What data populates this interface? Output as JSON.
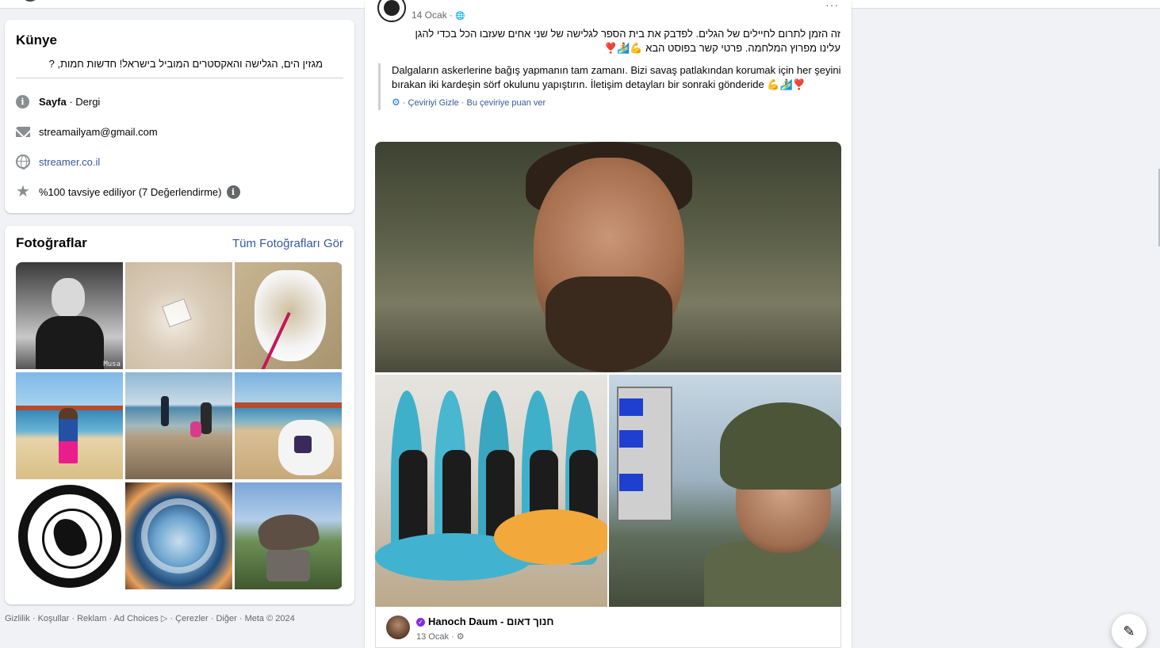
{
  "about": {
    "title": "Künye",
    "intro": "מגזין הים, הגלישה והאקסטרים המוביל בישראל! חדשות חמות, ?",
    "category_bold": "Sayfa",
    "category_rest": " · Dergi",
    "email": "streamailyam@gmail.com",
    "website": "streamer.co.il",
    "rating": "%100 tavsiye ediliyor (7 Değerlendirme)",
    "info_glyph": "i"
  },
  "photos": {
    "title": "Fotoğraflar",
    "see_all": "Tüm Fotoğrafları Gör",
    "tile1_watermark": "Musa"
  },
  "footer": {
    "links": [
      "Gizlilik",
      "Koşullar",
      "Reklam",
      "Ad Choices ▷",
      "Çerezler",
      "Diğer",
      "Meta © 2024"
    ],
    "separator": " · "
  },
  "post": {
    "date": "14 Ocak",
    "date_sep": " · ",
    "globe_glyph": "🌐",
    "more_glyph": "···",
    "text_he": "זה הזמן לתרום לחיילים של הגלים. לפדבק את בית הספר לגלישה של שני אחים שעזבו הכל בכדי להגן עלינו מפרוץ המלחמה. פרטי קשר בפוסט הבא 💪🏄❣️",
    "translation": "Dalgaların askerlerine bağış yapmanın tam zamanı. Bizi savaş patlakından korumak için her şeyini bırakan iki kardeşin sörf okulunu yapıştırın. İletişim detayları bir sonraki gönderide 💪🏄‍♂️❣️",
    "gear_glyph": "⚙",
    "hide_translation": "Çeviriyi Gizle",
    "rate_translation": "Bu çeviriye puan ver",
    "link_sep": " · "
  },
  "shared_post": {
    "author": "Hanoch Daum - חנוך דאום",
    "verified_glyph": "✓",
    "date": "13 Ocak",
    "date_sep": " · ",
    "gear_glyph": "⚙"
  },
  "compose_glyph": "✎",
  "colors": {
    "link": "#385898",
    "background": "#f0f2f5",
    "card": "#ffffff",
    "verified": "#8a2be2"
  }
}
